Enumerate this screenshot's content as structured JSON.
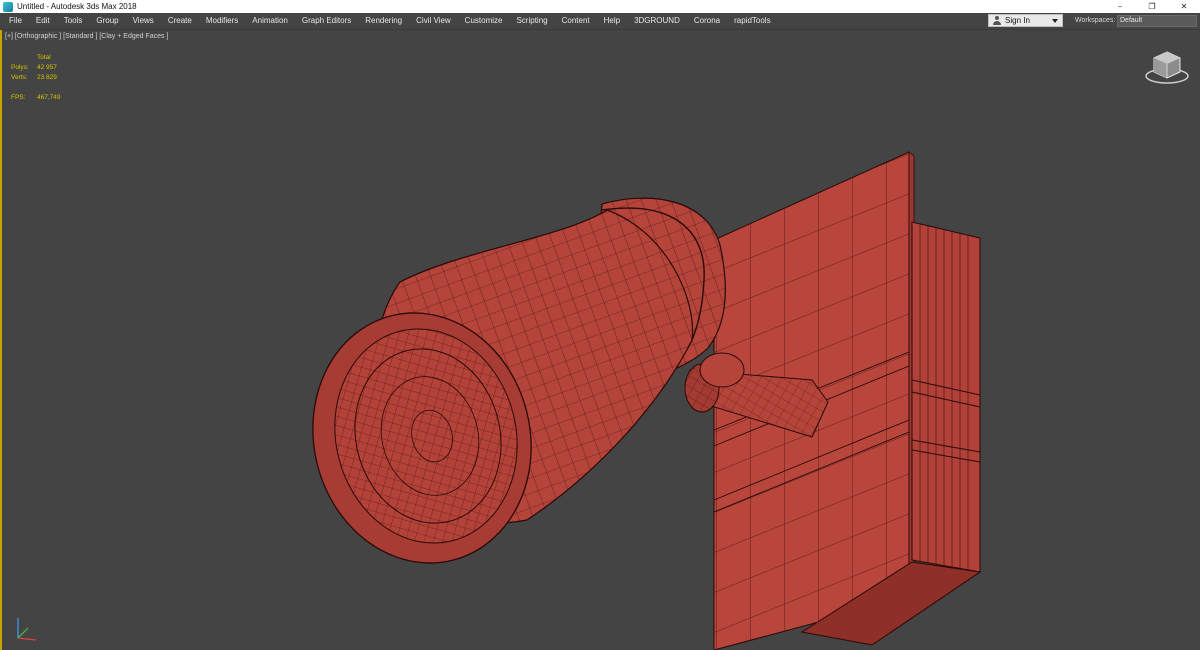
{
  "window": {
    "title": "Untitled - Autodesk 3ds Max 2018",
    "controls": {
      "minimize": "–",
      "restore": "❐",
      "close": "✕"
    }
  },
  "menubar": {
    "items": [
      "File",
      "Edit",
      "Tools",
      "Group",
      "Views",
      "Create",
      "Modifiers",
      "Animation",
      "Graph Editors",
      "Rendering",
      "Civil View",
      "Customize",
      "Scripting",
      "Content",
      "Help",
      "3DGROUND",
      "Corona",
      "rapidTools"
    ],
    "signin": "Sign In",
    "workspaces_label": "Workspaces:",
    "workspace_value": "Default"
  },
  "viewport": {
    "label": "[+] [Orthographic ] [Standard ] [Clay + Edged Faces ]",
    "stats": {
      "header": "Total",
      "polys_label": "Polys:",
      "polys_value": "42 957",
      "verts_label": "Verts:",
      "verts_value": "23 829",
      "fps_label": "FPS:",
      "fps_value": "467,749"
    }
  },
  "colors": {
    "clay": "#b5443b",
    "clay_dark": "#8a2e27",
    "wire": "#3a0d0a",
    "viewport_bg": "#444444",
    "active_border": "#c9a300",
    "stats_text": "#d8c400"
  },
  "icons": {
    "app": "3dsmax-app-icon",
    "viewcube": "viewcube-icon",
    "axis": "axis-tripod-icon",
    "user": "user-icon"
  }
}
